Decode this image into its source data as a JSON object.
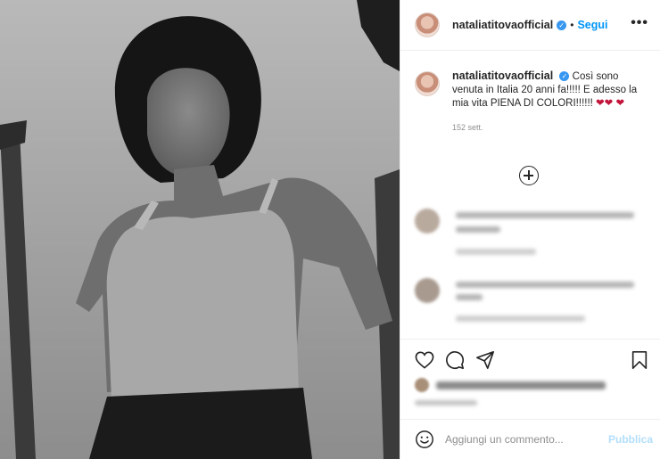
{
  "post": {
    "username": "nataliatitovaofficial",
    "follow_label": "Segui",
    "separator": "•",
    "more_icon": "more-dots-icon",
    "caption": {
      "username": "nataliatitovaofficial",
      "text": "Così sono venuta in Italia 20 anni fa!!!!! E adesso la mia vita PIENA DI COLORI!!!!!! ",
      "hearts": "❤❤ ❤"
    },
    "timestamp": "152 sett."
  },
  "add_comment": {
    "placeholder": "Aggiungi un commento...",
    "publish_label": "Pubblica"
  },
  "colors": {
    "accent": "#0095f6",
    "verified": "#3897f0",
    "heart": "#c2143b",
    "publish_disabled": "#b2dffc"
  }
}
